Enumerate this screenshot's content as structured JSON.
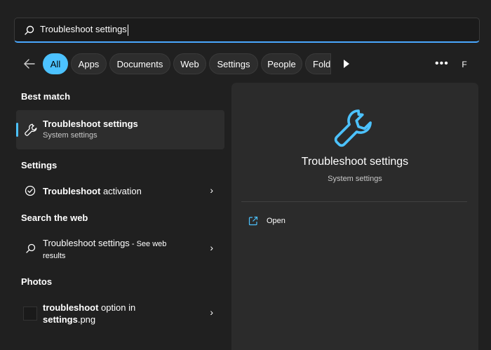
{
  "search": {
    "query": "Troubleshoot settings"
  },
  "filters": {
    "items": [
      "All",
      "Apps",
      "Documents",
      "Web",
      "Settings",
      "People",
      "Folde"
    ],
    "active": "All",
    "avatar_initial": "F"
  },
  "sections": {
    "best_match": "Best match",
    "settings": "Settings",
    "search_web": "Search the web",
    "photos": "Photos"
  },
  "best_match": {
    "title": "Troubleshoot settings",
    "subtitle": "System settings"
  },
  "settings_result": {
    "title_bold": "Troubleshoot",
    "title_rest": " activation"
  },
  "web_result": {
    "title": "Troubleshoot settings",
    "suffix": " - See web",
    "suffix2": "results"
  },
  "photo_result": {
    "line1_bold": "troubleshoot",
    "line1_rest": " option in",
    "line2_bold": "settings",
    "line2_rest": ".png"
  },
  "preview": {
    "title": "Troubleshoot settings",
    "subtitle": "System settings",
    "open_label": "Open"
  },
  "colors": {
    "accent": "#4cc2ff",
    "background": "#202020",
    "panel": "#2b2b2b"
  }
}
